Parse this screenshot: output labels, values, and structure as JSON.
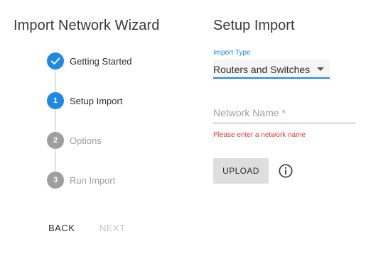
{
  "wizard": {
    "title": "Import Network Wizard",
    "steps": [
      {
        "number": "",
        "label": "Getting Started",
        "status": "completed",
        "icon": "check-icon"
      },
      {
        "number": "1",
        "label": "Setup Import",
        "status": "active"
      },
      {
        "number": "2",
        "label": "Options",
        "status": "pending"
      },
      {
        "number": "3",
        "label": "Run Import",
        "status": "pending"
      }
    ],
    "back_label": "BACK",
    "next_label": "NEXT"
  },
  "setup": {
    "title": "Setup Import",
    "import_type": {
      "label": "Import Type",
      "value": "Routers and Switches",
      "icon": "dropdown-arrow-icon"
    },
    "network_name": {
      "placeholder": "Network Name *",
      "value": "",
      "error": "Please enter a network name"
    },
    "upload_label": "UPLOAD",
    "info_icon": "info-icon"
  },
  "colors": {
    "accent": "#1e88e5",
    "error": "#e53935",
    "pending_step": "#9e9e9e",
    "disabled_text": "#c6c6c6"
  }
}
